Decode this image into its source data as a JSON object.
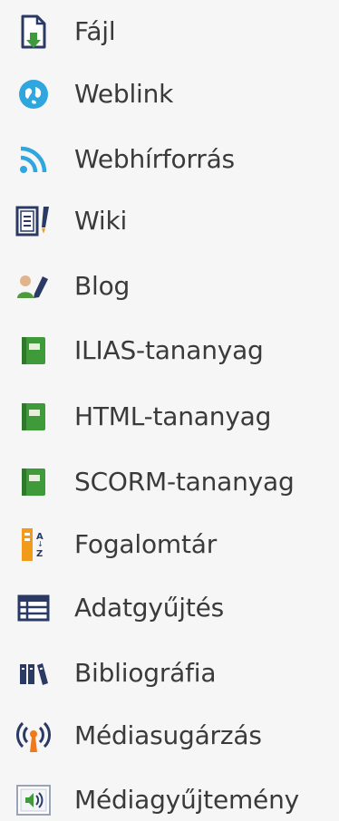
{
  "menu": {
    "items": [
      {
        "label": "Fájl",
        "icon": "file-icon"
      },
      {
        "label": "Weblink",
        "icon": "weblink-icon"
      },
      {
        "label": "Webhírforrás",
        "icon": "rss-feed-icon"
      },
      {
        "label": "Wiki",
        "icon": "wiki-icon"
      },
      {
        "label": "Blog",
        "icon": "blog-icon"
      },
      {
        "label": "ILIAS-tananyag",
        "icon": "learning-module-icon"
      },
      {
        "label": "HTML-tananyag",
        "icon": "learning-module-icon"
      },
      {
        "label": "SCORM-tananyag",
        "icon": "learning-module-icon"
      },
      {
        "label": "Fogalomtár",
        "icon": "glossary-icon"
      },
      {
        "label": "Adatgyűjtés",
        "icon": "data-collection-icon"
      },
      {
        "label": "Bibliográfia",
        "icon": "bibliography-icon"
      },
      {
        "label": "Médiasugárzás",
        "icon": "media-cast-icon"
      },
      {
        "label": "Médiagyűjtemény",
        "icon": "media-pool-icon"
      }
    ]
  }
}
